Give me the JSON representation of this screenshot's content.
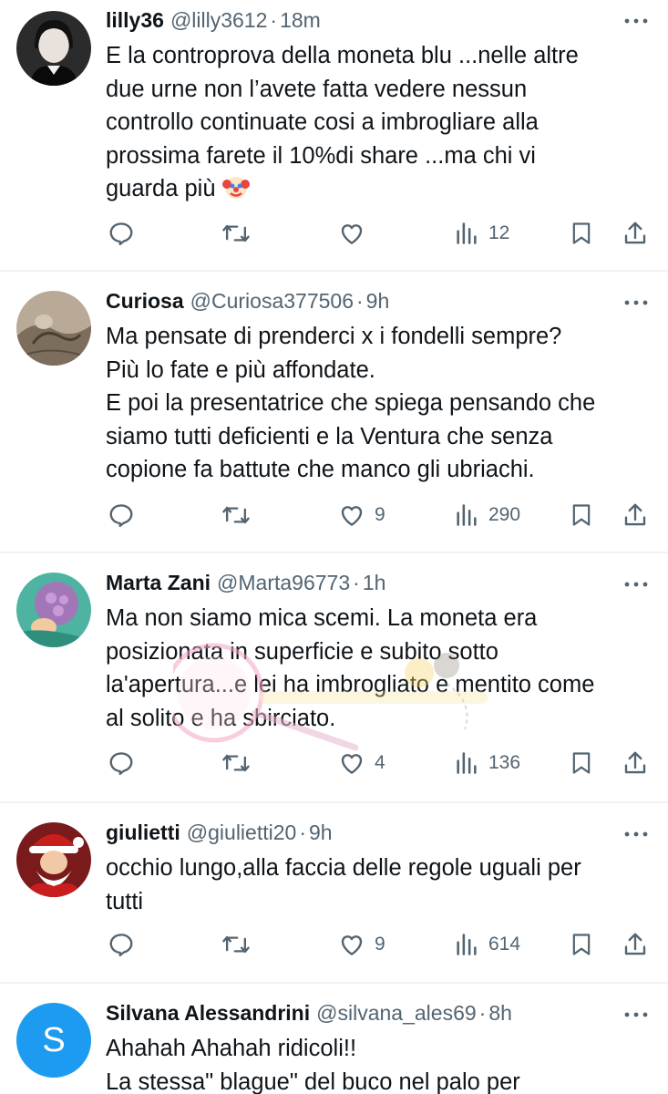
{
  "tweets": [
    {
      "name": "lilly36",
      "handle": "@lilly3612",
      "time": "18m",
      "text": "E la controprova della moneta blu ...nelle altre\ndue urne non l’avete fatta vedere nessun\ncontrollo  continuate cosi a imbrogliare alla\nprossima farete il 10%di share ...ma chi vi\nguarda più ",
      "replies": "",
      "retweets": "",
      "likes": "",
      "views": "12"
    },
    {
      "name": "Curiosa",
      "handle": "@Curiosa377506",
      "time": "9h",
      "text": "Ma pensate di prenderci x i fondelli sempre?\nPiù lo fate e più affondate.\nE poi la presentatrice che spiega pensando che\nsiamo tutti deficienti e la Ventura che senza\ncopione fa battute che manco gli ubriachi.",
      "replies": "",
      "retweets": "",
      "likes": "9",
      "views": "290"
    },
    {
      "name": "Marta Zani",
      "handle": "@Marta96773",
      "time": "1h",
      "text": "Ma non siamo mica scemi. La moneta era\nposizionata in superficie e subito sotto\nla'apertura...e lei ha imbrogliato e mentito come\nal solito e ha sbirciato.",
      "replies": "",
      "retweets": "",
      "likes": "4",
      "views": "136"
    },
    {
      "name": "giulietti",
      "handle": "@giulietti20",
      "time": "9h",
      "text": "occhio lungo,alla faccia delle regole uguali per\ntutti",
      "replies": "",
      "retweets": "",
      "likes": "9",
      "views": "614"
    },
    {
      "name": "Silvana Alessandrini",
      "handle": "@silvana_ales69",
      "time": "8h",
      "avatar_letter": "S",
      "text": "Ahahah Ahahah  ridicoli!!\nLa stessa\" blague\" del buco nel palo per"
    }
  ],
  "separator": "·",
  "colors": {
    "text": "#0f1419",
    "secondary": "#536471",
    "divider": "#eff3f4",
    "avatar_blue": "#1d9bf0"
  },
  "icons": [
    "reply-icon",
    "retweet-icon",
    "like-icon",
    "views-icon",
    "bookmark-icon",
    "share-icon",
    "more-icon",
    "clown-emoji"
  ]
}
